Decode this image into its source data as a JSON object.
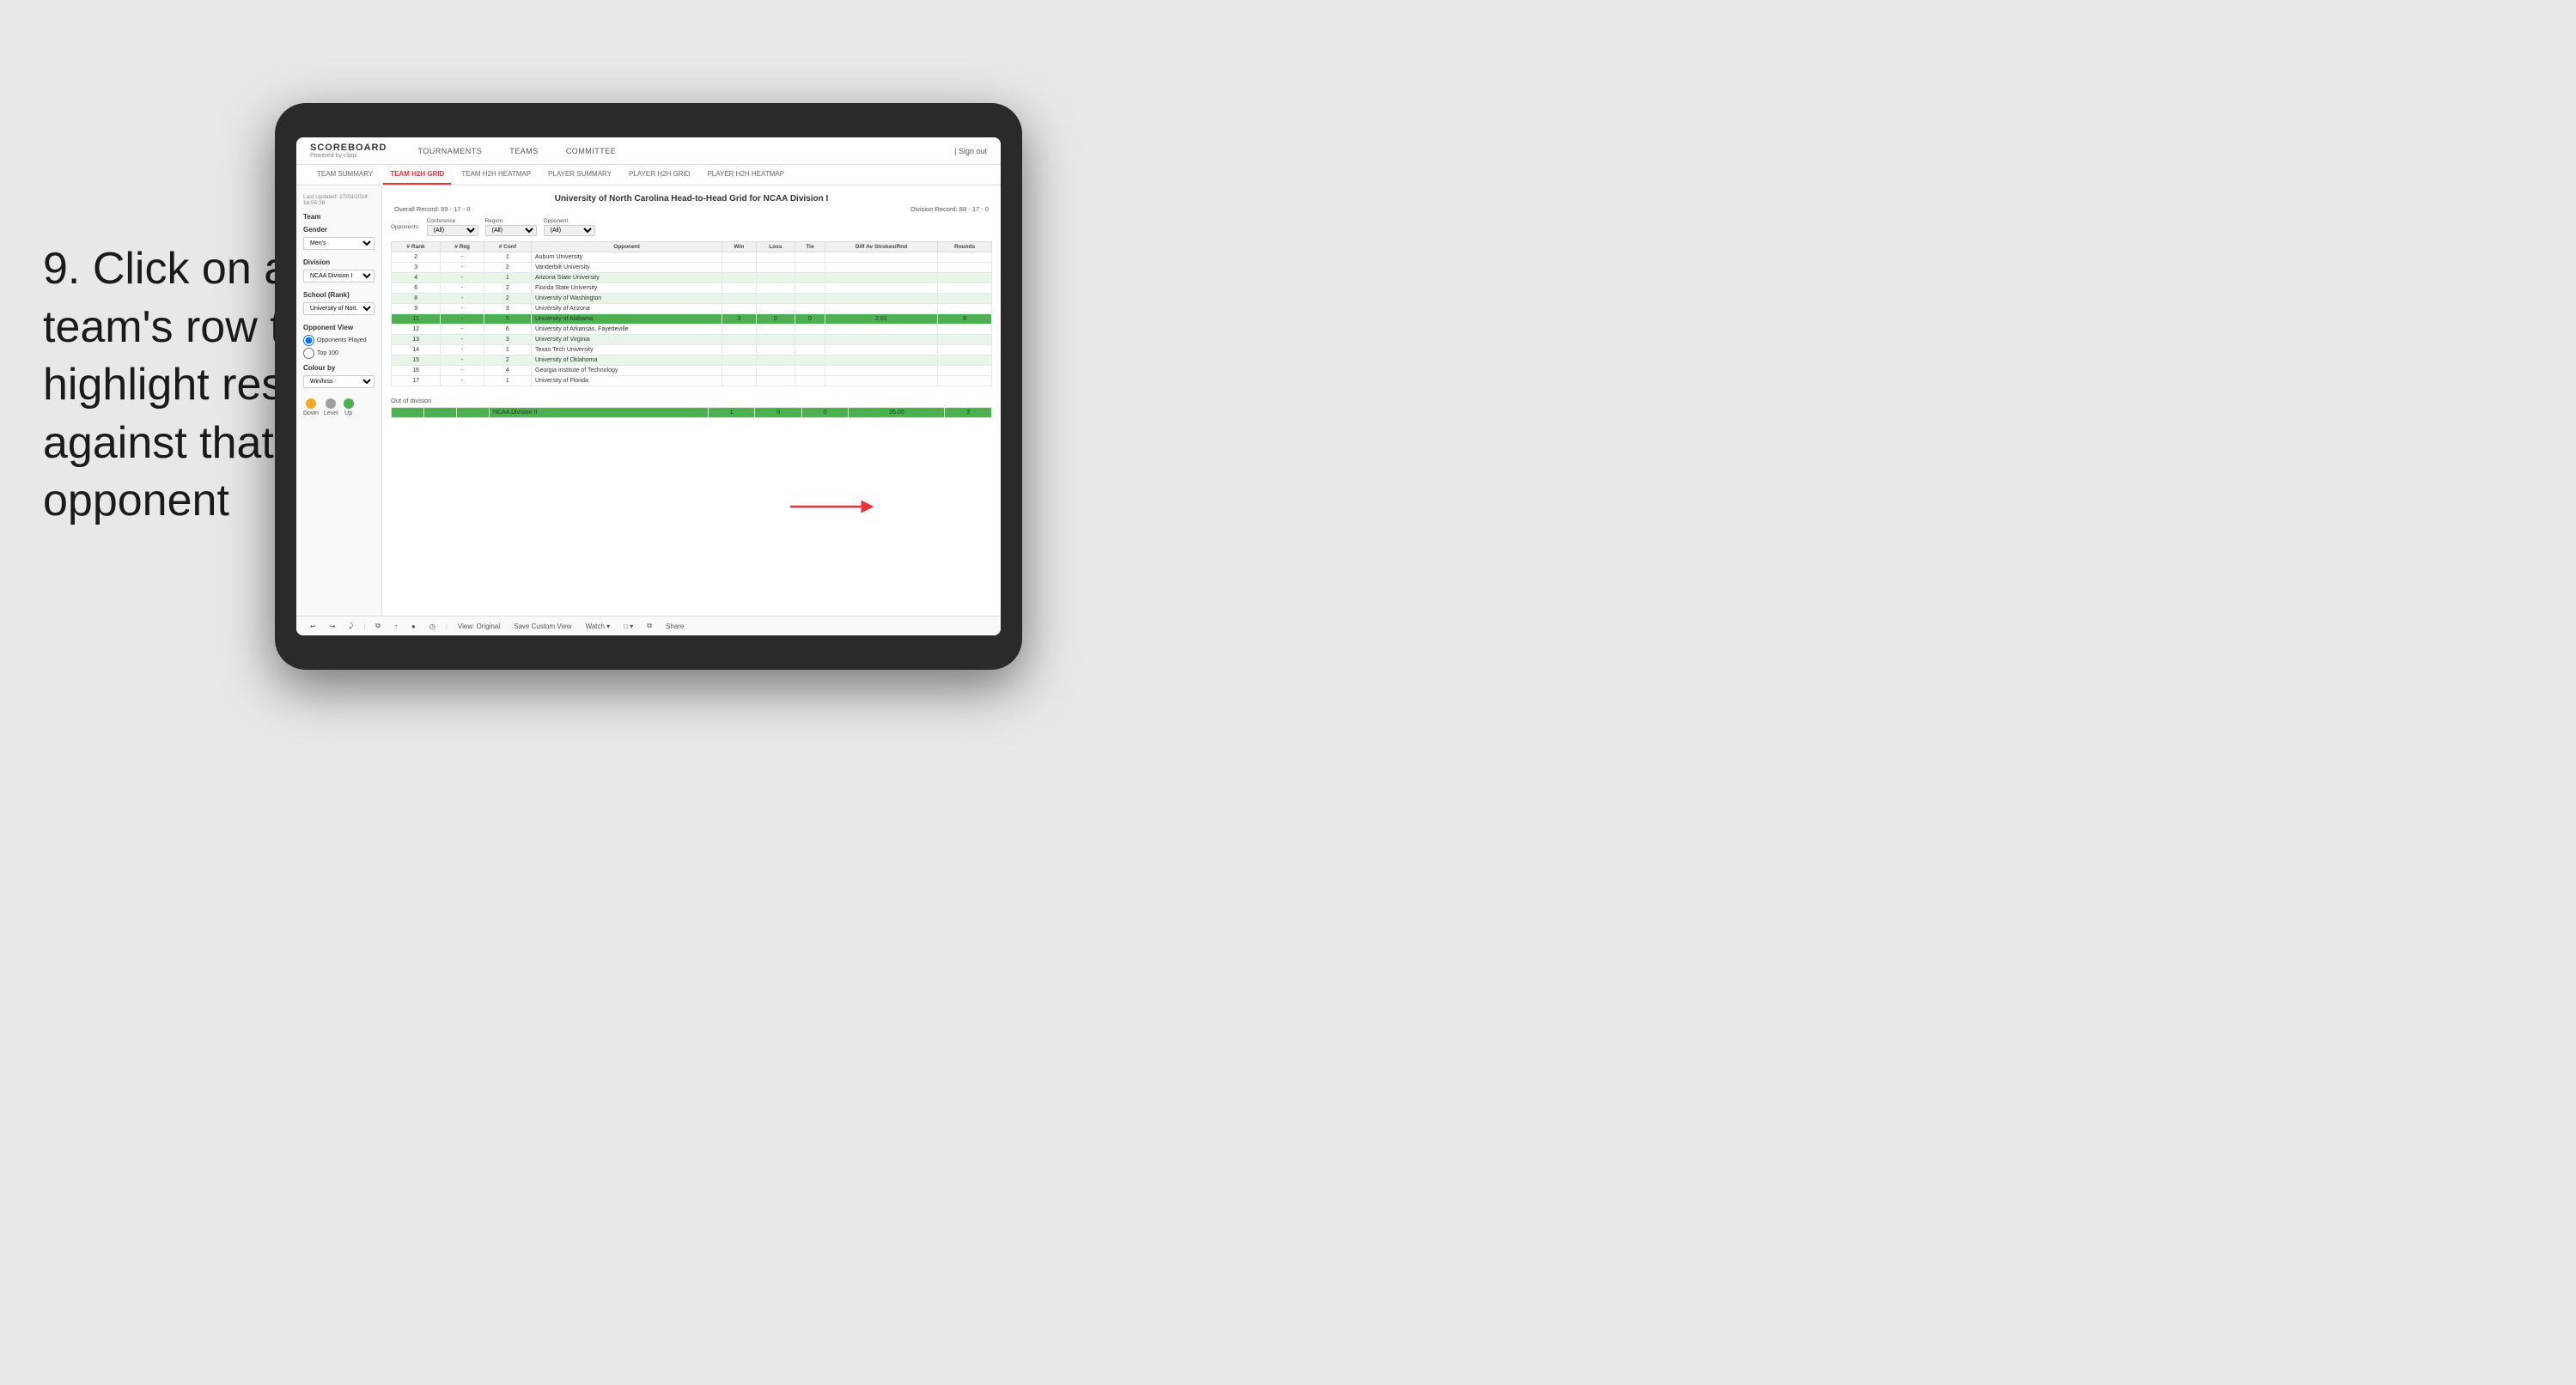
{
  "instruction": {
    "step": "9.",
    "text": "Click on a team's row to highlight results against that opponent"
  },
  "nav": {
    "logo": "SCOREBOARD",
    "logo_sub": "Powered by clippi",
    "items": [
      "TOURNAMENTS",
      "TEAMS",
      "COMMITTEE"
    ],
    "sign_out": "Sign out"
  },
  "sub_nav": {
    "items": [
      "TEAM SUMMARY",
      "TEAM H2H GRID",
      "TEAM H2H HEATMAP",
      "PLAYER SUMMARY",
      "PLAYER H2H GRID",
      "PLAYER H2H HEATMAP"
    ],
    "active": "TEAM H2H GRID"
  },
  "sidebar": {
    "timestamp_label": "Last Updated: 27/03/2024",
    "time": "16:55:38",
    "team_label": "Team",
    "gender_label": "Gender",
    "gender_value": "Men's",
    "division_label": "Division",
    "division_value": "NCAA Division I",
    "school_label": "School (Rank)",
    "school_value": "University of Nort...",
    "opponent_view_label": "Opponent View",
    "radio1": "Opponents Played",
    "radio2": "Top 100",
    "colour_label": "Colour by",
    "colour_value": "Win/loss",
    "legend": [
      {
        "color": "#f9a825",
        "label": "Down"
      },
      {
        "color": "#9e9e9e",
        "label": "Level"
      },
      {
        "color": "#4caf50",
        "label": "Up"
      }
    ]
  },
  "grid": {
    "title": "University of North Carolina Head-to-Head Grid for NCAA Division I",
    "overall_record": "Overall Record: 89 - 17 - 0",
    "division_record": "Division Record: 88 - 17 - 0",
    "filters": {
      "opponents_label": "Opponents:",
      "conference_label": "Conference",
      "conference_value": "(All)",
      "region_label": "Region",
      "region_value": "(All)",
      "opponent_label": "Opponent",
      "opponent_value": "(All)"
    },
    "table_headers": [
      "# Rank",
      "# Reg",
      "# Conf",
      "Opponent",
      "Win",
      "Loss",
      "Tie",
      "Diff Av Strokes/Rnd",
      "Rounds"
    ],
    "rows": [
      {
        "rank": "2",
        "reg": "-",
        "conf": "1",
        "opponent": "Auburn University",
        "win": "",
        "loss": "",
        "tie": "",
        "diff": "",
        "rounds": "",
        "style": "normal"
      },
      {
        "rank": "3",
        "reg": "-",
        "conf": "2",
        "opponent": "Vanderbilt University",
        "win": "",
        "loss": "",
        "tie": "",
        "diff": "",
        "rounds": "",
        "style": "normal"
      },
      {
        "rank": "4",
        "reg": "-",
        "conf": "1",
        "opponent": "Arizona State University",
        "win": "",
        "loss": "",
        "tie": "",
        "diff": "",
        "rounds": "",
        "style": "light-green"
      },
      {
        "rank": "6",
        "reg": "-",
        "conf": "2",
        "opponent": "Florida State University",
        "win": "",
        "loss": "",
        "tie": "",
        "diff": "",
        "rounds": "",
        "style": "normal"
      },
      {
        "rank": "8",
        "reg": "-",
        "conf": "2",
        "opponent": "University of Washington",
        "win": "",
        "loss": "",
        "tie": "",
        "diff": "",
        "rounds": "",
        "style": "light-green"
      },
      {
        "rank": "9",
        "reg": "-",
        "conf": "3",
        "opponent": "University of Arizona",
        "win": "",
        "loss": "",
        "tie": "",
        "diff": "",
        "rounds": "",
        "style": "normal"
      },
      {
        "rank": "11",
        "reg": "-",
        "conf": "5",
        "opponent": "University of Alabama",
        "win": "3",
        "loss": "0",
        "tie": "0",
        "diff": "2.61",
        "rounds": "8",
        "style": "highlighted"
      },
      {
        "rank": "12",
        "reg": "-",
        "conf": "6",
        "opponent": "University of Arkansas, Fayetteville",
        "win": "",
        "loss": "",
        "tie": "",
        "diff": "",
        "rounds": "",
        "style": "normal"
      },
      {
        "rank": "13",
        "reg": "-",
        "conf": "3",
        "opponent": "University of Virginia",
        "win": "",
        "loss": "",
        "tie": "",
        "diff": "",
        "rounds": "",
        "style": "light-green"
      },
      {
        "rank": "14",
        "reg": "-",
        "conf": "1",
        "opponent": "Texas Tech University",
        "win": "",
        "loss": "",
        "tie": "",
        "diff": "",
        "rounds": "",
        "style": "normal"
      },
      {
        "rank": "15",
        "reg": "-",
        "conf": "2",
        "opponent": "University of Oklahoma",
        "win": "",
        "loss": "",
        "tie": "",
        "diff": "",
        "rounds": "",
        "style": "light-green"
      },
      {
        "rank": "16",
        "reg": "-",
        "conf": "4",
        "opponent": "Georgia Institute of Technology",
        "win": "",
        "loss": "",
        "tie": "",
        "diff": "",
        "rounds": "",
        "style": "normal"
      },
      {
        "rank": "17",
        "reg": "-",
        "conf": "1",
        "opponent": "University of Florida",
        "win": "",
        "loss": "",
        "tie": "",
        "diff": "",
        "rounds": "",
        "style": "normal"
      }
    ],
    "out_of_division_label": "Out of division",
    "out_of_division_row": {
      "label": "NCAA Division II",
      "win": "1",
      "loss": "0",
      "tie": "0",
      "diff": "26.00",
      "rounds": "3"
    }
  },
  "toolbar": {
    "buttons": [
      "↩",
      "↪",
      "⤸",
      "⧉",
      "↑",
      "●",
      "◷",
      "View: Original",
      "Save Custom View",
      "Watch ▾",
      "□ ▾",
      "⧉",
      "Share"
    ]
  }
}
